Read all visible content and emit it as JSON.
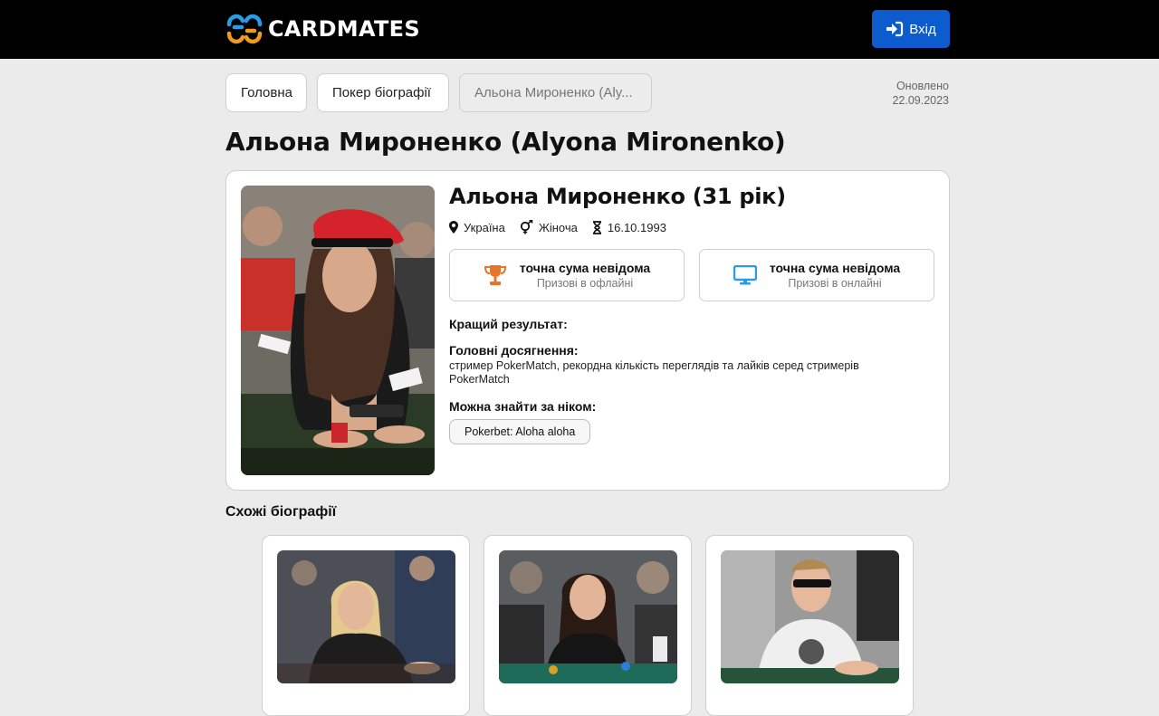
{
  "header": {
    "logo_text": "CARDMATES",
    "login_label": "Вхід"
  },
  "breadcrumbs": [
    {
      "label": "Головна"
    },
    {
      "label": "Покер біографії"
    },
    {
      "label": "Альона Мироненко (Aly..."
    }
  ],
  "updated": {
    "label": "Оновлено",
    "date": "22.09.2023"
  },
  "page_title": "Альона Мироненко (Alyona Mironenko)",
  "profile": {
    "name_age": "Альона Мироненко (31 рік)",
    "country": "Україна",
    "gender": "Жіноча",
    "birthdate": "16.10.1993",
    "prizes": [
      {
        "amount": "точна сума невідома",
        "label": "Призові в офлайні",
        "icon": "trophy-icon",
        "color": "#e8742a"
      },
      {
        "amount": "точна сума невідома",
        "label": "Призові в онлайні",
        "icon": "monitor-icon",
        "color": "#2a9be8"
      }
    ],
    "best_result_title": "Кращий результат:",
    "achievements_title": "Головні досягнення:",
    "achievements_text": "стример PokerMatch, рекордна кількість переглядів та лайків серед стримерів PokerMatch",
    "nick_title": "Можна знайти за ніком:",
    "nick_tag": "Pokerbet: Aloha aloha"
  },
  "similar": {
    "title": "Схожі біографії",
    "cards": [
      {},
      {},
      {}
    ]
  }
}
